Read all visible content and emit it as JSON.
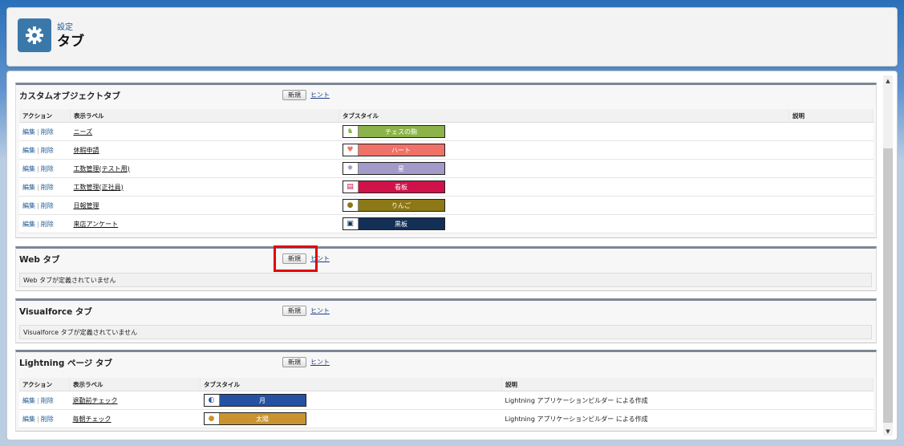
{
  "header": {
    "breadcrumb": "設定",
    "title": "タブ",
    "icon": "gear-icon"
  },
  "custom_tabs": {
    "title": "カスタムオブジェクトタブ",
    "new_label": "新規",
    "hint_label": "ヒント",
    "columns": [
      "アクション",
      "表示ラベル",
      "タブスタイル",
      "説明"
    ],
    "edit": "編集",
    "delete": "削除",
    "rows": [
      {
        "label": "ニーズ",
        "style": "チェスの駒",
        "color": "#8bb34a",
        "icon": "chess-knight-icon",
        "glyph": "♞"
      },
      {
        "label": "休暇申請",
        "style": "ハート",
        "color": "#f07167",
        "icon": "heart-icon",
        "glyph": "♥"
      },
      {
        "label": "工数管理(テスト用)",
        "style": "星",
        "color": "#a49ac9",
        "icon": "star-icon",
        "glyph": "✹"
      },
      {
        "label": "工数管理(正社員)",
        "style": "看板",
        "color": "#d0114a",
        "icon": "signboard-icon",
        "glyph": "▤"
      },
      {
        "label": "日報管理",
        "style": "りんご",
        "color": "#8c7817",
        "icon": "apple-icon",
        "glyph": "●"
      },
      {
        "label": "来店アンケート",
        "style": "黒板",
        "color": "#132f55",
        "icon": "chalkboard-icon",
        "glyph": "▣"
      }
    ]
  },
  "web_tabs": {
    "title": "Web タブ",
    "new_label": "新規",
    "hint_label": "ヒント",
    "empty": "Web タブが定義されていません"
  },
  "vf_tabs": {
    "title": "Visualforce タブ",
    "new_label": "新規",
    "hint_label": "ヒント",
    "empty": "Visualforce タブが定義されていません"
  },
  "lightning_tabs": {
    "title": "Lightning ページ タブ",
    "new_label": "新規",
    "hint_label": "ヒント",
    "columns": [
      "アクション",
      "表示ラベル",
      "タブスタイル",
      "説明"
    ],
    "edit": "編集",
    "delete": "削除",
    "rows": [
      {
        "label": "退勤前チェック",
        "style": "月",
        "color": "#2451a3",
        "icon": "moon-icon",
        "glyph": "◐",
        "desc": "Lightning アプリケーションビルダー による作成"
      },
      {
        "label": "毎朝チェック",
        "style": "太陽",
        "color": "#c9942f",
        "icon": "sun-icon",
        "glyph": "●",
        "desc": "Lightning アプリケーションビルダー による作成"
      }
    ]
  }
}
